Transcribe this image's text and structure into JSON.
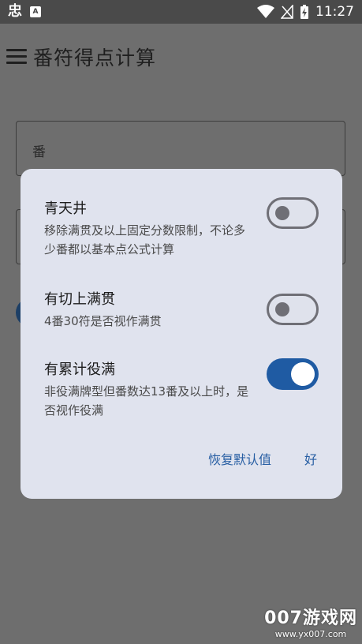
{
  "status_bar": {
    "app_glyph": "忠",
    "a_badge": "A",
    "time": "11:27"
  },
  "app_bar": {
    "title": "番符得点计算"
  },
  "background_fields": [
    {
      "label": "番"
    },
    {
      "label": ""
    }
  ],
  "dialog": {
    "settings": [
      {
        "title": "青天井",
        "description": "移除满贯及以上固定分数限制，不论多少番都以基本点公式计算",
        "enabled": false
      },
      {
        "title": "有切上满贯",
        "description": "4番30符是否视作满贯",
        "enabled": false
      },
      {
        "title": "有累计役满",
        "description": "非役满牌型但番数达13番及以上时，是否视作役满",
        "enabled": true
      }
    ],
    "actions": {
      "reset": "恢复默认值",
      "ok": "好"
    }
  },
  "watermark": {
    "brand": "007游戏网",
    "url": "www.yx007.com"
  },
  "colors": {
    "accent": "#1f5ba3",
    "dialog_bg": "#e0e3ee",
    "scrim": "#6e6e6e"
  }
}
